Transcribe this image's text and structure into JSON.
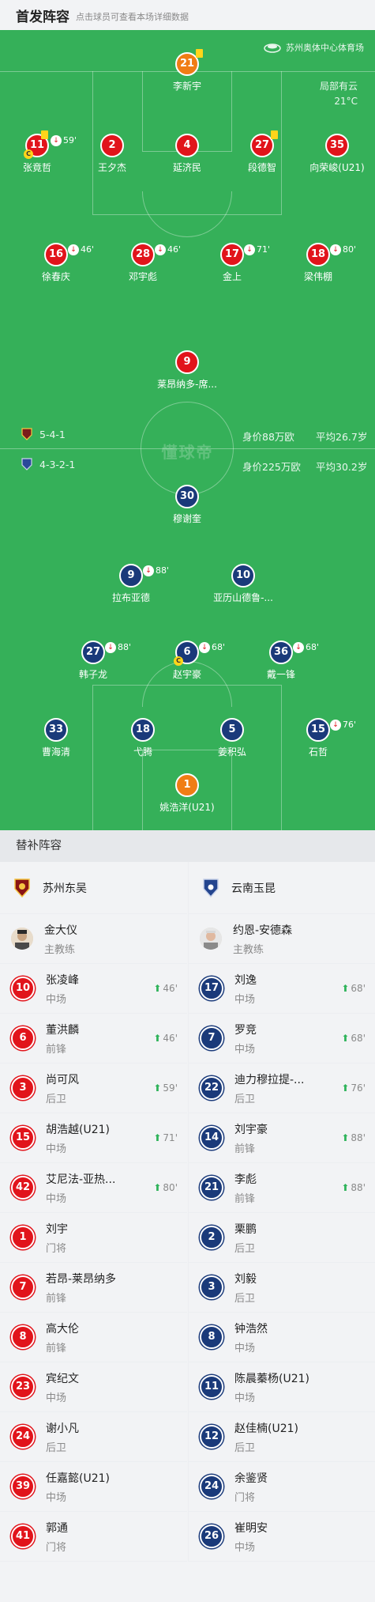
{
  "header": {
    "title": "首发阵容",
    "hint": "点击球员可查看本场详细数据"
  },
  "venue": {
    "name": "苏州奥体中心体育场",
    "weather": "局部有云",
    "temp": "21°C"
  },
  "watermark": "懂球帝",
  "home": {
    "name": "苏州东吴",
    "formation": "5-4-1",
    "value": "身价88万欧",
    "avg_age": "平均26.7岁",
    "color": "#e1141b",
    "coach": {
      "name": "金大仪",
      "role": "主教练"
    },
    "lineup": [
      {
        "num": "21",
        "name": "李新宇",
        "color": "orange",
        "yellow": true
      },
      {
        "num": "11",
        "name": "张竟哲",
        "sub": "59'",
        "yellow": true,
        "captain": true
      },
      {
        "num": "2",
        "name": "王夕杰"
      },
      {
        "num": "4",
        "name": "延济民"
      },
      {
        "num": "27",
        "name": "段德智",
        "yellow": true
      },
      {
        "num": "35",
        "name": "向荣峻(U21)"
      },
      {
        "num": "16",
        "name": "徐春庆",
        "sub": "46'"
      },
      {
        "num": "28",
        "name": "邓宇彪",
        "sub": "46'"
      },
      {
        "num": "17",
        "name": "金上",
        "sub": "71'"
      },
      {
        "num": "18",
        "name": "梁伟棚",
        "sub": "80'"
      },
      {
        "num": "9",
        "name": "莱昂纳多-席..."
      }
    ],
    "subs": [
      {
        "num": "10",
        "name": "张凌峰",
        "role": "中场",
        "in": "46'"
      },
      {
        "num": "6",
        "name": "董洪麟",
        "role": "前锋",
        "in": "46'"
      },
      {
        "num": "3",
        "name": "尚可风",
        "role": "后卫",
        "in": "59'"
      },
      {
        "num": "15",
        "name": "胡浩越(U21)",
        "role": "中场",
        "in": "71'"
      },
      {
        "num": "42",
        "name": "艾尼法-亚热...",
        "role": "中场",
        "in": "80'"
      },
      {
        "num": "1",
        "name": "刘宇",
        "role": "门将"
      },
      {
        "num": "7",
        "name": "若昂-莱昂纳多",
        "role": "前锋"
      },
      {
        "num": "8",
        "name": "高大伦",
        "role": "前锋"
      },
      {
        "num": "23",
        "name": "宾纪文",
        "role": "中场"
      },
      {
        "num": "24",
        "name": "谢小凡",
        "role": "后卫"
      },
      {
        "num": "39",
        "name": "任嘉懿(U21)",
        "role": "中场"
      },
      {
        "num": "41",
        "name": "郭通",
        "role": "门将"
      }
    ]
  },
  "away": {
    "name": "云南玉昆",
    "formation": "4-3-2-1",
    "value": "身价225万欧",
    "avg_age": "平均30.2岁",
    "color": "#1a3a7a",
    "coach": {
      "name": "约恩-安德森",
      "role": "主教练"
    },
    "lineup": [
      {
        "num": "30",
        "name": "穆谢奎"
      },
      {
        "num": "9",
        "name": "拉布亚德",
        "sub": "88'"
      },
      {
        "num": "10",
        "name": "亚历山德鲁-..."
      },
      {
        "num": "27",
        "name": "韩子龙",
        "sub": "88'"
      },
      {
        "num": "6",
        "name": "赵宇豪",
        "sub": "68'",
        "captain": true
      },
      {
        "num": "36",
        "name": "戴一锋",
        "sub": "68'"
      },
      {
        "num": "33",
        "name": "曹海清"
      },
      {
        "num": "18",
        "name": "弋腾"
      },
      {
        "num": "5",
        "name": "姜积弘"
      },
      {
        "num": "15",
        "name": "石哲",
        "sub": "76'"
      },
      {
        "num": "1",
        "name": "姚浩洋(U21)",
        "color": "orange"
      }
    ],
    "subs": [
      {
        "num": "17",
        "name": "刘逸",
        "role": "中场",
        "in": "68'"
      },
      {
        "num": "7",
        "name": "罗竞",
        "role": "中场",
        "in": "68'"
      },
      {
        "num": "22",
        "name": "迪力穆拉提-...",
        "role": "后卫",
        "in": "76'"
      },
      {
        "num": "14",
        "name": "刘宇豪",
        "role": "前锋",
        "in": "88'"
      },
      {
        "num": "21",
        "name": "李彪",
        "role": "前锋",
        "in": "88'"
      },
      {
        "num": "2",
        "name": "栗鹏",
        "role": "后卫"
      },
      {
        "num": "3",
        "name": "刘毅",
        "role": "后卫"
      },
      {
        "num": "8",
        "name": "钟浩然",
        "role": "中场"
      },
      {
        "num": "11",
        "name": "陈晨蓁杨(U21)",
        "role": "中场"
      },
      {
        "num": "12",
        "name": "赵佳楠(U21)",
        "role": "后卫"
      },
      {
        "num": "24",
        "name": "余鉴贤",
        "role": "门将"
      },
      {
        "num": "26",
        "name": "崔明安",
        "role": "中场"
      }
    ]
  },
  "subs_title": "替补阵容"
}
